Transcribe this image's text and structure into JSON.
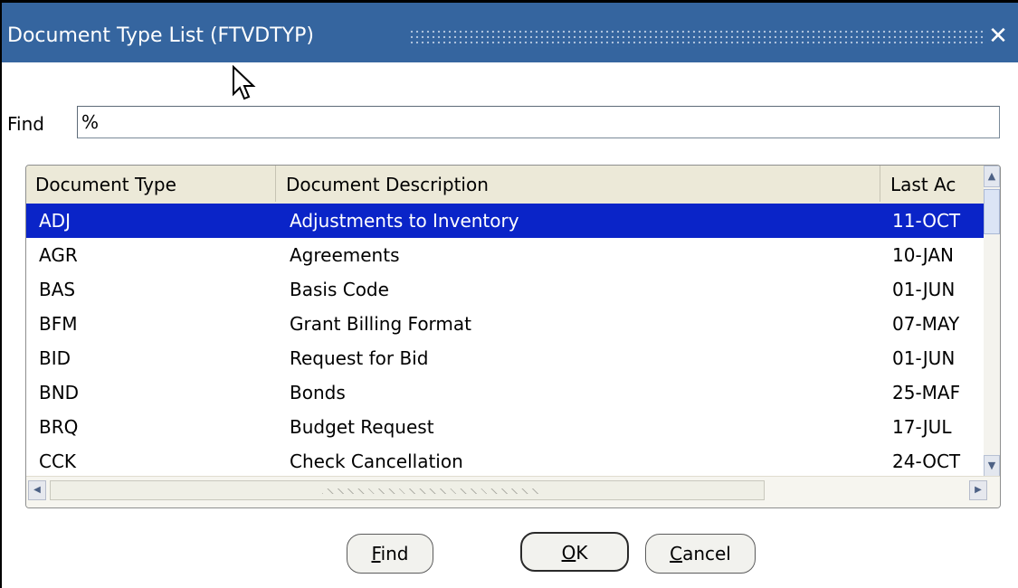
{
  "window": {
    "title": "Document Type List (FTVDTYP)",
    "close_label": "✕"
  },
  "find": {
    "label": "Find",
    "value": "%"
  },
  "table": {
    "headers": [
      "Document Type",
      "Document Description",
      "Last Ac"
    ],
    "rows": [
      {
        "type": "ADJ",
        "description": "Adjustments to Inventory",
        "last": "11-OCT",
        "selected": true
      },
      {
        "type": "AGR",
        "description": "Agreements",
        "last": "10-JAN"
      },
      {
        "type": "BAS",
        "description": "Basis Code",
        "last": "01-JUN"
      },
      {
        "type": "BFM",
        "description": "Grant Billing Format",
        "last": "07-MAY"
      },
      {
        "type": "BID",
        "description": "Request for Bid",
        "last": "01-JUN"
      },
      {
        "type": "BND",
        "description": "Bonds",
        "last": "25-MAF"
      },
      {
        "type": "BRQ",
        "description": "Budget Request",
        "last": "17-JUL"
      },
      {
        "type": "CCK",
        "description": "Check Cancellation",
        "last": "24-OCT"
      }
    ]
  },
  "buttons": {
    "find": {
      "pre": "",
      "ul": "F",
      "post": "ind"
    },
    "ok": {
      "pre": "",
      "ul": "O",
      "post": "K"
    },
    "cancel": {
      "pre": "",
      "ul": "C",
      "post": "ancel"
    }
  },
  "colors": {
    "titlebar": "#35659f",
    "selected_row": "#0a24c8",
    "list_bg": "#ece9d8"
  }
}
